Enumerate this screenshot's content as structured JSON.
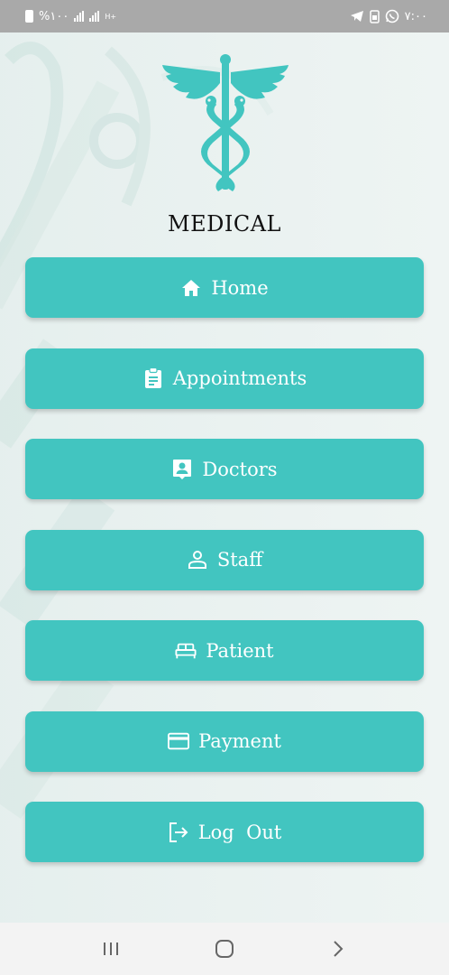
{
  "status_bar": {
    "left_text": "%١٠٠",
    "time": "٧:٠٠",
    "network_label": "H+"
  },
  "brand": {
    "title": "MEDICAL",
    "accent_color": "#42c5c0"
  },
  "menu": {
    "items": [
      {
        "label": "Home",
        "icon": "home-icon"
      },
      {
        "label": "Appointments",
        "icon": "clipboard-icon"
      },
      {
        "label": "Doctors",
        "icon": "doctor-badge-icon"
      },
      {
        "label": "Staff",
        "icon": "person-icon"
      },
      {
        "label": "Patient",
        "icon": "bed-icon"
      },
      {
        "label": "Payment",
        "icon": "credit-card-icon"
      },
      {
        "label": "Log  Out",
        "icon": "logout-icon"
      }
    ]
  },
  "nav_bar": {
    "items": [
      "recent-apps-icon",
      "home-circle-icon",
      "back-chevron-icon"
    ]
  }
}
